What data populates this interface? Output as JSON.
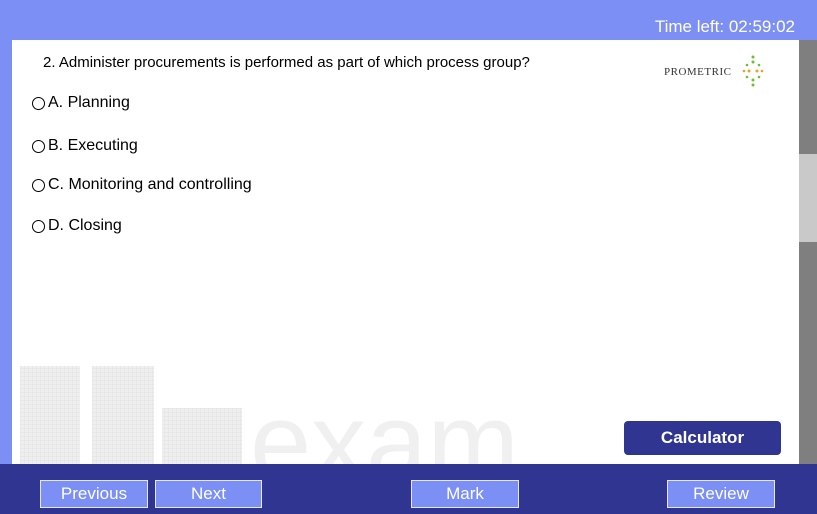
{
  "header": {
    "timer_text": "Time left: 02:59:02"
  },
  "question": {
    "text": "2. Administer procurements is performed as part of which process group?"
  },
  "logo": {
    "text": "PROMETRIC"
  },
  "options": [
    {
      "label": "A. Planning"
    },
    {
      "label": "B. Executing"
    },
    {
      "label": "C. Monitoring and controlling"
    },
    {
      "label": "D. Closing"
    }
  ],
  "watermark": {
    "text": "exam"
  },
  "calculator": {
    "label": "Calculator"
  },
  "nav": {
    "previous": "Previous",
    "next": "Next",
    "mark": "Mark",
    "review": "Review"
  },
  "colors": {
    "accent": "#7b8ff5",
    "dark": "#2f3590"
  }
}
